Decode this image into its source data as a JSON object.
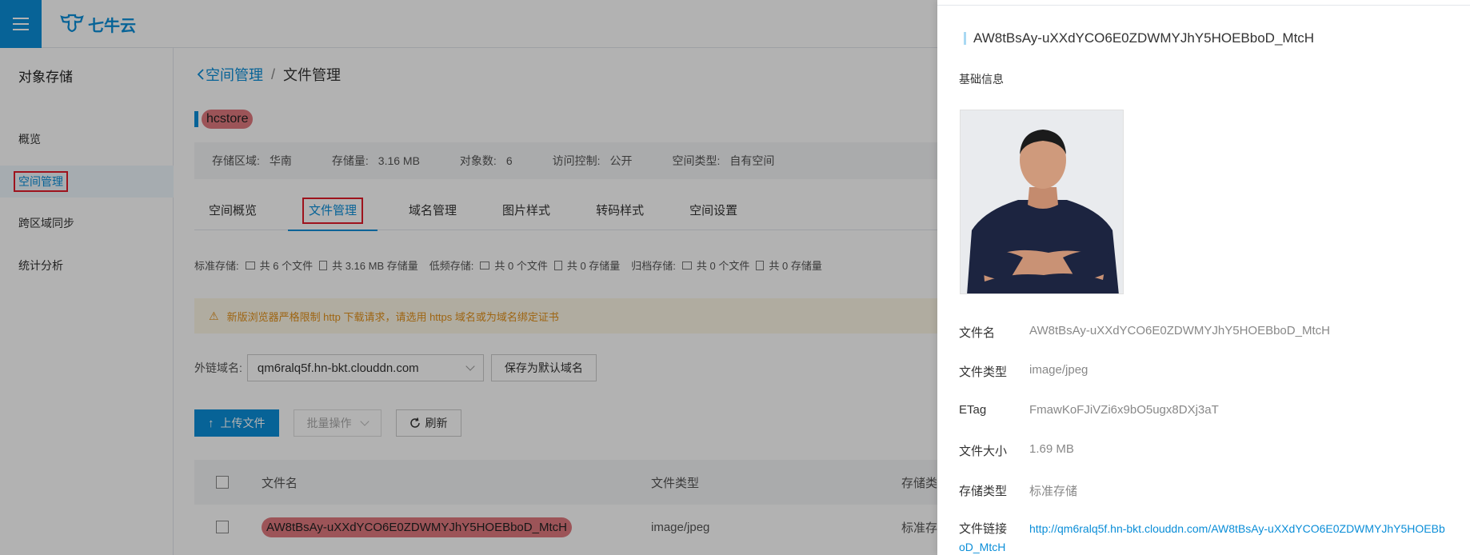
{
  "logo": {
    "text": "七牛云"
  },
  "sidebar": {
    "title": "对象存储",
    "items": [
      {
        "label": "概览"
      },
      {
        "label": "空间管理"
      },
      {
        "label": "跨区域同步"
      },
      {
        "label": "统计分析"
      }
    ]
  },
  "breadcrumb": {
    "back": "空间管理",
    "sep": "/",
    "current": "文件管理"
  },
  "bucket": {
    "name": "hcstore"
  },
  "info": {
    "region_label": "存储区域:",
    "region": "华南",
    "size_label": "存储量:",
    "size": "3.16 MB",
    "count_label": "对象数:",
    "count": "6",
    "access_label": "访问控制:",
    "access": "公开",
    "type_label": "空间类型:",
    "type": "自有空间"
  },
  "tabs": [
    {
      "label": "空间概览"
    },
    {
      "label": "文件管理"
    },
    {
      "label": "域名管理"
    },
    {
      "label": "图片样式"
    },
    {
      "label": "转码样式"
    },
    {
      "label": "空间设置"
    }
  ],
  "stats": {
    "std_label": "标准存储:",
    "std_files": "共 6 个文件",
    "std_size": "共 3.16 MB 存储量",
    "low_label": "低频存储:",
    "low_files": "共 0 个文件",
    "low_size": "共 0 存储量",
    "arch_label": "归档存储:",
    "arch_files": "共 0 个文件",
    "arch_size": "共 0 存储量"
  },
  "warning": {
    "text": "新版浏览器严格限制 http 下载请求，请选用 https 域名或为域名绑定证书"
  },
  "domain": {
    "label": "外链域名:",
    "value": "qm6ralq5f.hn-bkt.clouddn.com",
    "save_default": "保存为默认域名"
  },
  "actions": {
    "upload": "上传文件",
    "batch": "批量操作",
    "refresh": "刷新"
  },
  "table": {
    "headers": {
      "name": "文件名",
      "type": "文件类型",
      "store": "存储类型"
    },
    "rows": [
      {
        "name": "AW8tBsAy-uXXdYCO6E0ZDWMYJhY5HOEBboD_MtcH",
        "type": "image/jpeg",
        "store": "标准存储"
      }
    ]
  },
  "drawer": {
    "title": "AW8tBsAy-uXXdYCO6E0ZDWMYJhY5HOEBboD_MtcH",
    "section": "基础信息",
    "fields": {
      "name_k": "文件名",
      "name_v": "AW8tBsAy-uXXdYCO6E0ZDWMYJhY5HOEBboD_MtcH",
      "type_k": "文件类型",
      "type_v": "image/jpeg",
      "etag_k": "ETag",
      "etag_v": "FmawKoFJiVZi6x9bO5ugx8DXj3aT",
      "size_k": "文件大小",
      "size_v": "1.69 MB",
      "store_k": "存储类型",
      "store_v": "标准存储",
      "link_k": "文件链接",
      "link_v": "http://qm6ralq5f.hn-bkt.clouddn.com/AW8tBsAy-uXXdYCO6E0ZDWMYJhY5HOEBboD_MtcH"
    }
  },
  "colors": {
    "accent": "#0b8ed8",
    "highlight": "#e0797e",
    "warn": "#e3911b"
  }
}
